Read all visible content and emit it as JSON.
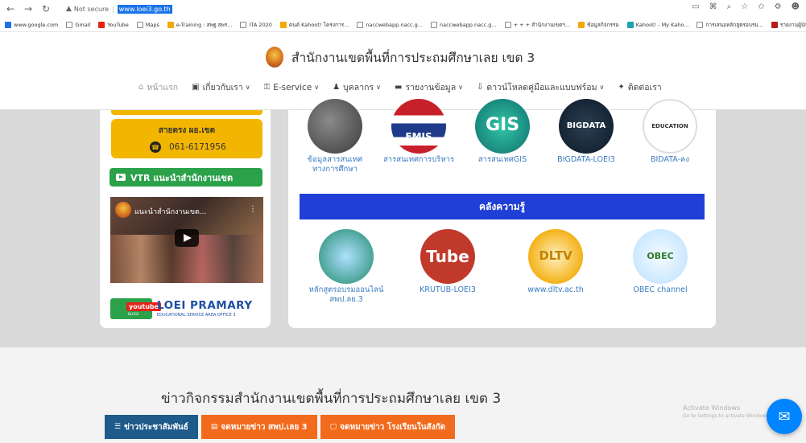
{
  "browser": {
    "security_label": "Not secure",
    "url": "www.loei3.go.th",
    "bookmarks": [
      "www.google.com",
      "Gmail",
      "YouTube",
      "Maps",
      "e-Training : สพฐ.สพร...",
      "ITA 2020",
      "คนค์ Kahoot! โครงการ...",
      "naccwebapp.nacc.g...",
      "naccwebapp.nacc.g...",
      "+ + + สำนักงานเขตฯ...",
      "ข้อมูลกิจกรรม",
      "Kahoot! - My Kaho...",
      "การเสนอหลักสูตรอบรม...",
      "รายงานผู้บักศึกษาสื่อรักษ์..."
    ]
  },
  "site": {
    "title": "สำนักงานเขตพื้นที่การประถมศึกษาเลย เขต 3",
    "menu": [
      {
        "icon": "⌂",
        "label": "หน้าแรก",
        "has_caret": false
      },
      {
        "icon": "▣",
        "label": "เกี่ยวกับเรา",
        "has_caret": true
      },
      {
        "icon": "⚿",
        "label": "E-service",
        "has_caret": true
      },
      {
        "icon": "♟",
        "label": "บุคลากร",
        "has_caret": true
      },
      {
        "icon": "▬",
        "label": "รายงานข้อมูล",
        "has_caret": true
      },
      {
        "icon": "⇩",
        "label": "ดาวน์โหลดคู่มือและแบบฟร์อม",
        "has_caret": true
      },
      {
        "icon": "✦",
        "label": "ติดต่อเรา",
        "has_caret": false
      }
    ]
  },
  "left": {
    "hotline_title": "สายตรง ผอ.เขต",
    "hotline_phone": "061-6171956",
    "vtr_label": "VTR แนะนำสำนักงานเขต",
    "video_title": "แนะนำสำนักงานเขต...",
    "yt_badge_word": "youtube",
    "yt_badge_sub": "BLOGS",
    "yt_brand": "LOEI PRAMARY",
    "yt_tagline": "EDUCATIONAL SERVICE AREA OFFICE 3"
  },
  "tiles_row1": [
    {
      "label": "ข้อมูลสารสนเทศทางการศึกษา",
      "circle_text": ""
    },
    {
      "label": "สารสนเทศการบริหาร",
      "circle_text": "EMIS"
    },
    {
      "label": "สารสนเทศGIS",
      "circle_text": "GIS"
    },
    {
      "label": "BIGDATA-LOEI3",
      "circle_text": "BIGDATA"
    },
    {
      "label": "BIDATA-คง",
      "circle_text": "EDUCATION"
    }
  ],
  "knowledge_title": "คลังความรู้",
  "tiles_row2": [
    {
      "label": "หลักสูตรอบรมออนไลน์ สพป.ลย.3",
      "circle_text": ""
    },
    {
      "label": "KRUTUB-LOEI3",
      "circle_text": "Tube"
    },
    {
      "label": "www.dltv.ac.th",
      "circle_text": "DLTV"
    },
    {
      "label": "OBEC channel",
      "circle_text": "OBEC"
    }
  ],
  "news": {
    "heading": "ข่าวกิจกรรมสำนักงานเขตพื้นที่การประถมศึกษาเลย เขต 3",
    "tabs": [
      "ข่าวประชาสัมพันธ์",
      "จดหมายข่าว สพป.เลย 3",
      "จดหมายข่าว โรงเรียนในสังกัด"
    ]
  },
  "windows_watermark": {
    "line1": "Activate Windows",
    "line2": "Go to Settings to activate Windows."
  }
}
